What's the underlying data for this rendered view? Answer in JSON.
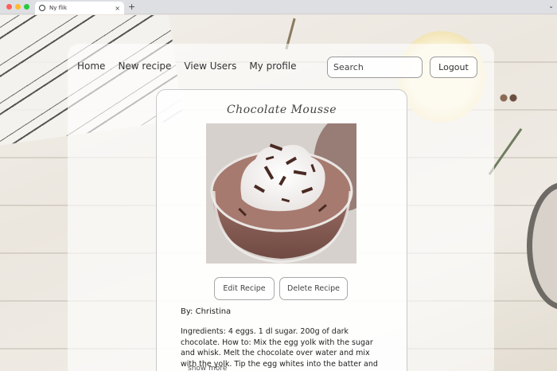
{
  "browser": {
    "tab_title": "Ny flik",
    "tab_close": "×",
    "new_tab": "+",
    "menu_chevron": "⌄"
  },
  "nav": {
    "home": "Home",
    "new_recipe": "New recipe",
    "view_users": "View Users",
    "my_profile": "My profile"
  },
  "search": {
    "placeholder": "Search",
    "value": ""
  },
  "logout_label": "Logout",
  "recipe": {
    "title": "Chocolate Mousse",
    "image_alt_icon": "chocolate-mousse-photo",
    "edit_label": "Edit Recipe",
    "delete_label": "Delete Recipe",
    "author": "By: Christina",
    "ingredients": "Ingredients: 4 eggs. 1 dl sugar. 200g of dark chocolate. How to: Mix the egg yolk with the sugar and whisk. Melt the chocolate over water and mix with the yolk. Tip the egg whites into the batter and",
    "show_more": "show more"
  },
  "colors": {
    "panel": "#ffffff",
    "text": "#333333",
    "border": "#9a9a9a"
  }
}
